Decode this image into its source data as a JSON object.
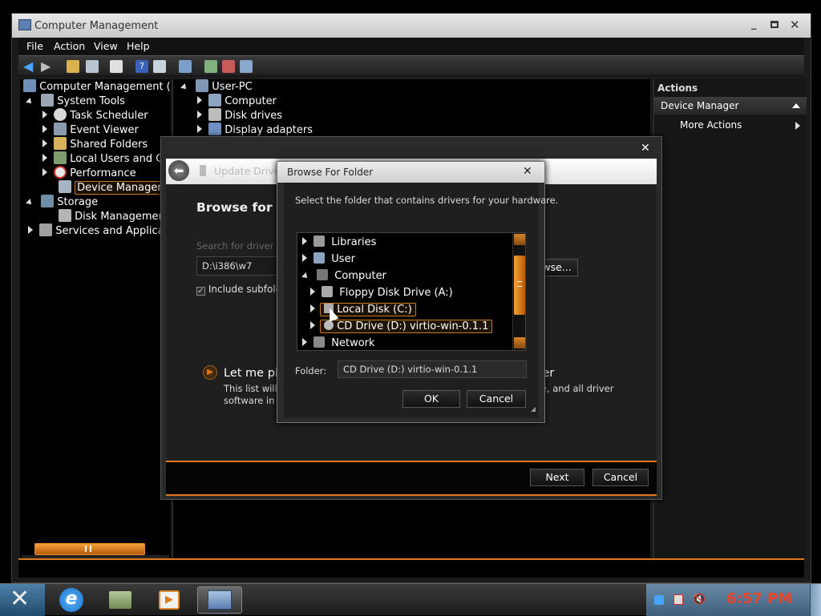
{
  "window": {
    "title": "Computer Management",
    "controls": [
      "_",
      "□",
      "✕"
    ]
  },
  "menu": [
    "File",
    "Action",
    "View",
    "Help"
  ],
  "tree": {
    "root": "Computer Management (Local)",
    "system_tools": "System Tools",
    "task_scheduler": "Task Scheduler",
    "event_viewer": "Event Viewer",
    "shared_folders": "Shared Folders",
    "local_users": "Local Users and Groups",
    "performance": "Performance",
    "device_manager": "Device Manager",
    "storage": "Storage",
    "disk_management": "Disk Management",
    "services": "Services and Applications"
  },
  "devices": {
    "root": "User-PC",
    "items": [
      "Computer",
      "Disk drives",
      "Display adapters"
    ]
  },
  "actions": {
    "header": "Actions",
    "section": "Device Manager",
    "more": "More Actions"
  },
  "wizard": {
    "title": "Update Driver Software",
    "heading": "Browse for drivers on your computer",
    "search_label": "Search for driver software in this location:",
    "path_value": "D:\\i386\\w7",
    "browse_button": "Browse...",
    "include_subfolders": "Include subfolders",
    "let_me_pick": "Let me pick from a list of device drivers on my computer",
    "desc_line1": "This list will show installed driver software compatible with the device, and all driver",
    "desc_line2": "software in the same category as the device.",
    "next_button": "Next",
    "cancel_button": "Cancel"
  },
  "browse": {
    "title": "Browse For Folder",
    "instruction": "Select the folder that contains drivers for your hardware.",
    "items": {
      "libraries": "Libraries",
      "user": "User",
      "computer": "Computer",
      "floppy": "Floppy Disk Drive (A:)",
      "local_disk": "Local Disk (C:)",
      "cd_drive": "CD Drive (D:) virtio-win-0.1.1",
      "network": "Network"
    },
    "folder_label": "Folder:",
    "folder_value": "CD Drive (D:) virtio-win-0.1.1",
    "ok_button": "OK",
    "cancel_button": "Cancel"
  },
  "taskbar": {
    "clock": "6:57 PM"
  },
  "colors": {
    "accent": "#e07b18",
    "clock": "#e8452a"
  }
}
